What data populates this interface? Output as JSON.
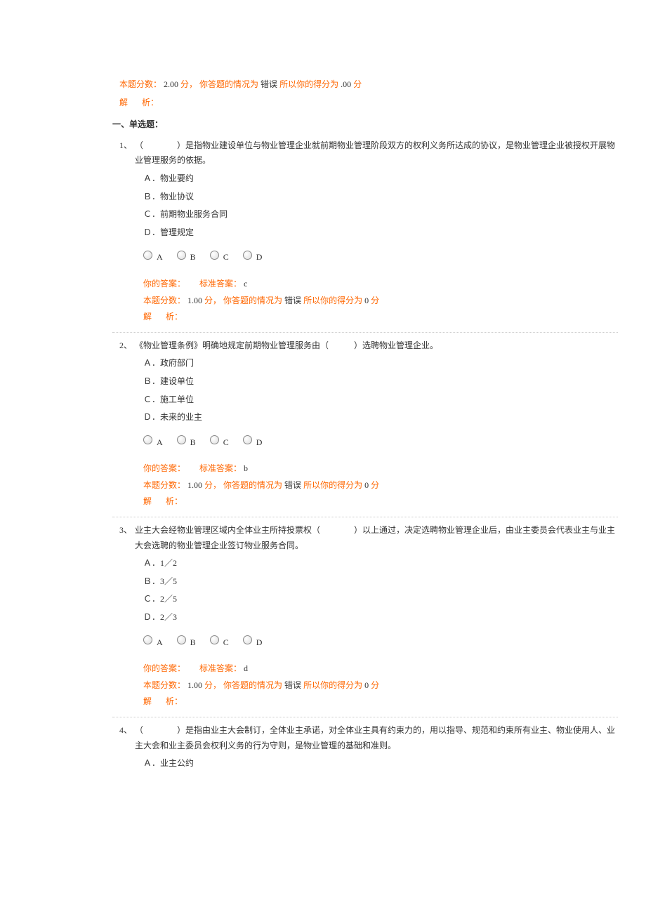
{
  "pre_block": {
    "score_label": "本题分数：",
    "score_val": "2.00",
    "score_unit": "分，",
    "status_label": "你答题的情况为",
    "status_val": "错误",
    "so_label": "所以你的得分为",
    "so_val": ".00",
    "so_unit": "分",
    "analysis_label": "解",
    "analysis_label2": "析："
  },
  "section_title": "一、单选题：",
  "common": {
    "your_answer_label": "你的答案：",
    "std_answer_label": "标准答案：",
    "score_label": "本题分数：",
    "score_unit": "分，",
    "status_label": "你答题的情况为",
    "status_val": "错误",
    "so_label": "所以你的得分为",
    "so_unit": "分",
    "analysis_label": "解",
    "analysis_label2": "析：",
    "opt_a": "A",
    "opt_b": "B",
    "opt_c": "C",
    "opt_d": "D"
  },
  "questions": [
    {
      "num": "1、",
      "text": "（　　　　）是指物业建设单位与物业管理企业就前期物业管理阶段双方的权利义务所达成的协议，是物业管理企业被授权开展物业管理服务的依据。",
      "opts": [
        "Ａ．物业要约",
        "Ｂ．物业协议",
        "Ｃ．前期物业服务合同",
        "Ｄ．管理规定"
      ],
      "std": "c",
      "score": "1.00",
      "got": "0"
    },
    {
      "num": "2、",
      "text": "《物业管理条例》明确地规定前期物业管理服务由（　　　）选聘物业管理企业。",
      "opts": [
        "Ａ．政府部门",
        "Ｂ．建设单位",
        "Ｃ．施工单位",
        "Ｄ．未来的业主"
      ],
      "std": "b",
      "score": "1.00",
      "got": "0"
    },
    {
      "num": "3、",
      "text": "业主大会经物业管理区域内全体业主所持投票权（　　　　）以上通过，决定选聘物业管理企业后，由业主委员会代表业主与业主大会选聘的物业管理企业签订物业服务合同。",
      "opts": [
        "Ａ．1／2",
        "Ｂ．3／5",
        "Ｃ．2／5",
        "Ｄ．2／3"
      ],
      "std": "d",
      "score": "1.00",
      "got": "0"
    },
    {
      "num": "4、",
      "text": "（　　　　）是指由业主大会制订，全体业主承诺，对全体业主具有约束力的，用以指导、规范和约束所有业主、物业使用人、业主大会和业主委员会权利义务的行为守则，是物业管理的基础和准则。",
      "opts": [
        "Ａ．业主公约"
      ],
      "std": "",
      "score": "",
      "got": ""
    }
  ]
}
